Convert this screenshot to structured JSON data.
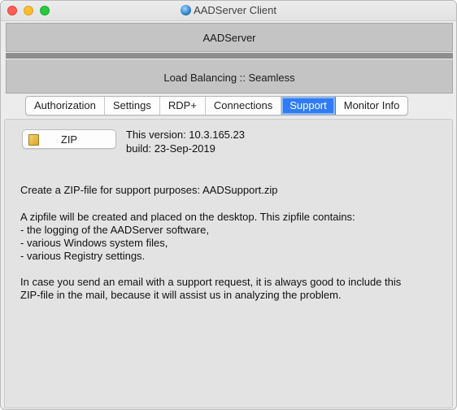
{
  "window": {
    "title": "AADServer Client"
  },
  "header": {
    "server_name": "AADServer",
    "load_balancing": "Load Balancing :: Seamless"
  },
  "tabs": [
    {
      "label": "Authorization",
      "active": false
    },
    {
      "label": "Settings",
      "active": false
    },
    {
      "label": "RDP+",
      "active": false
    },
    {
      "label": "Connections",
      "active": false
    },
    {
      "label": "Support",
      "active": true
    },
    {
      "label": "Monitor Info",
      "active": false
    }
  ],
  "support": {
    "zip_button": "ZIP",
    "version": "This version: 10.3.165.23",
    "build": "build: 23-Sep-2019",
    "create_line": "Create a ZIP-file for support purposes: AADSupport.zip",
    "desc_lines": [
      "A zipfile will be created and placed on the desktop. This zipfile contains:",
      "- the logging of the AADServer software,",
      "- various Windows system files,",
      "- various Registry settings."
    ],
    "email_lines": [
      "In case you send an email with a support request, it is always good to include this",
      "ZIP-file in the mail, because it will assist us in analyzing the problem."
    ]
  },
  "colors": {
    "accent": "#2f7cf6",
    "bar": "#c4c4c4",
    "separator": "#8e8e8e"
  }
}
